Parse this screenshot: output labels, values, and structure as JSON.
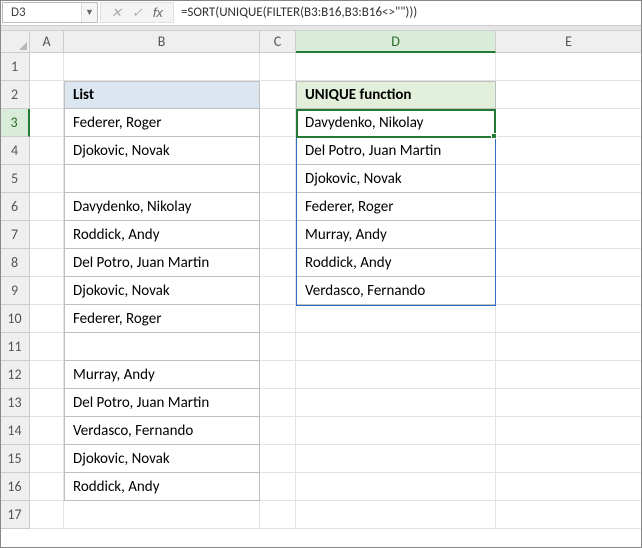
{
  "namebox": {
    "value": "D3"
  },
  "formula_bar": {
    "cancel_glyph": "✕",
    "confirm_glyph": "✓",
    "fx_glyph": "fx",
    "formula": "=SORT(UNIQUE(FILTER(B3:B16,B3:B16<>\"\")))"
  },
  "columns": {
    "A": "A",
    "B": "B",
    "C": "C",
    "D": "D",
    "E": "E"
  },
  "row_numbers": [
    "1",
    "2",
    "3",
    "4",
    "5",
    "6",
    "7",
    "8",
    "9",
    "10",
    "11",
    "12",
    "13",
    "14",
    "15",
    "16",
    "17"
  ],
  "list": {
    "header": "List",
    "values": [
      "Federer, Roger",
      "Djokovic, Novak",
      "",
      "Davydenko, Nikolay",
      "Roddick, Andy",
      "Del Potro, Juan Martin",
      "Djokovic, Novak",
      "Federer, Roger",
      "",
      "Murray, Andy",
      "Del Potro, Juan Martin",
      "Verdasco, Fernando",
      "Djokovic, Novak",
      "Roddick, Andy"
    ]
  },
  "unique": {
    "header": "UNIQUE function",
    "values": [
      "Davydenko, Nikolay",
      "Del Potro, Juan Martin",
      "Djokovic, Novak",
      "Federer, Roger",
      "Murray, Andy",
      "Roddick, Andy",
      "Verdasco, Fernando"
    ]
  },
  "active_cell": "D3"
}
